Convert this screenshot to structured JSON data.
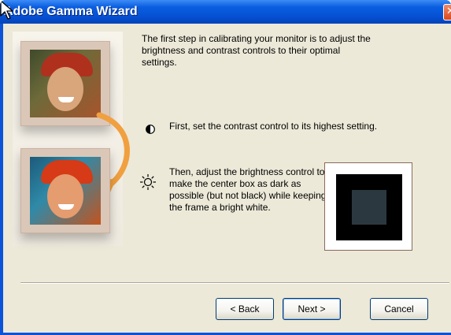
{
  "window": {
    "title": "Adobe Gamma Wizard",
    "close_glyph": "✕"
  },
  "content": {
    "intro": "The first step in calibrating your monitor is to adjust the brightness and contrast controls to their optimal settings.",
    "contrast_step": "First, set the contrast control to its highest setting.",
    "brightness_step": "Then, adjust the brightness control to make the center box as dark as possible (but not black) while keeping the frame a bright white."
  },
  "buttons": {
    "back": "< Back",
    "next": "Next >",
    "cancel": "Cancel"
  },
  "icons": {
    "contrast": "contrast-half-circle-icon",
    "brightness": "sun-icon",
    "close": "close-icon",
    "cursor": "mouse-pointer-icon"
  },
  "colors": {
    "titlebar": "#0a5ee0",
    "client_bg": "#ece9d8",
    "test_outer": "#000000",
    "test_inner": "#2c3840"
  }
}
